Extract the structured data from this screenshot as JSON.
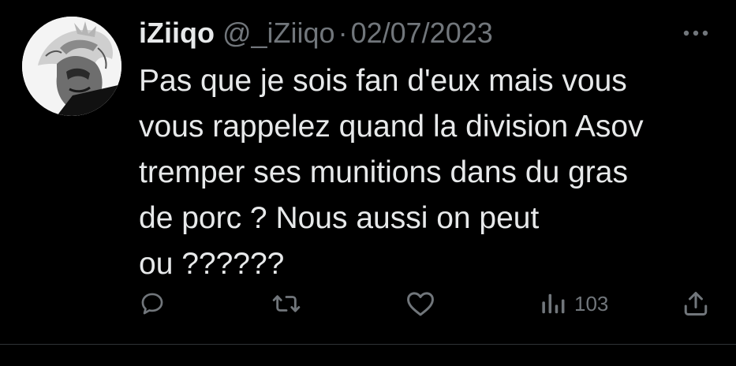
{
  "tweet": {
    "display_name": "iZiiqo",
    "handle": "@_iZiiqo",
    "separator": "·",
    "date": "02/07/2023",
    "text": "Pas que je sois fan d'eux mais vous\nvous rappelez quand la division Asov\ntremper ses munitions dans du gras\nde porc ? Nous aussi on peut\nou ??????",
    "views": "103"
  },
  "icons": {
    "avatar": "profile-avatar",
    "more": "more-icon",
    "reply": "reply-icon",
    "retweet": "retweet-icon",
    "like": "like-icon",
    "views": "views-icon",
    "share": "share-icon"
  },
  "colors": {
    "background": "#000000",
    "text": "#e7e9ea",
    "secondary": "#71767b",
    "divider": "#2f3336"
  }
}
